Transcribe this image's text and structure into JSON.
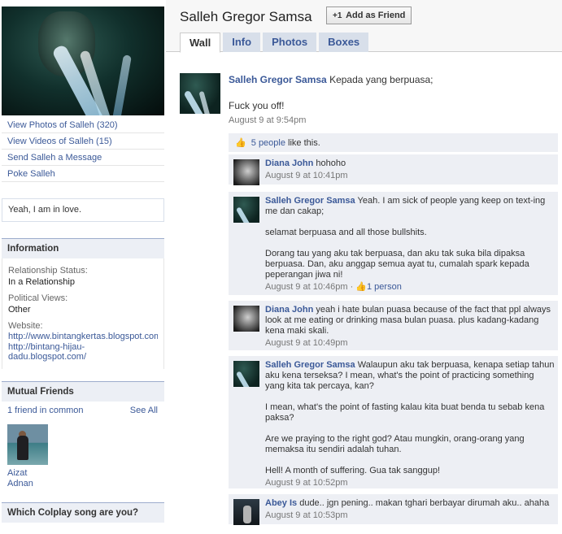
{
  "profile": {
    "name": "Salleh Gregor Samsa",
    "links": [
      "View Photos of Salleh (320)",
      "View Videos of Salleh (15)",
      "Send Salleh a Message",
      "Poke Salleh"
    ],
    "status": "Yeah, I am in love."
  },
  "information": {
    "heading": "Information",
    "relationship_label": "Relationship Status:",
    "relationship_value": "In a Relationship",
    "political_label": "Political Views:",
    "political_value": "Other",
    "website_label": "Website:",
    "website_1": "http://www.bintangkertas.blogspot.com",
    "website_2a": "http://bintang-hijau-",
    "website_2b": "dadu.blogspot.com/"
  },
  "mutual_friends": {
    "heading": "Mutual Friends",
    "count_text": "1 friend in common",
    "see_all": "See All",
    "friend_first": "Aizat",
    "friend_last": "Adnan"
  },
  "quiz": {
    "heading": "Which Colplay song are you?"
  },
  "header": {
    "add_friend": "Add as Friend",
    "add_icon": "+1",
    "tabs": [
      "Wall",
      "Info",
      "Photos",
      "Boxes"
    ]
  },
  "story": {
    "author": "Salleh Gregor Samsa",
    "text1": "Kepada yang berpuasa;",
    "text2": "Fuck you off!",
    "time": "August 9 at 9:54pm",
    "likes_count": "5 people",
    "likes_suffix": "like this."
  },
  "comments": [
    {
      "author": "Diana John",
      "paras": [
        "hohoho"
      ],
      "time": "August 9 at 10:41pm"
    },
    {
      "author": "Salleh Gregor Samsa",
      "paras": [
        "Yeah. I am sick of people yang keep on text-ing me dan cakap;",
        "selamat berpuasa and all those bullshits.",
        "Dorang tau yang aku tak berpuasa, dan aku tak suka bila dipaksa berpuasa. Dan, aku anggap semua ayat tu, cumalah spark kepada peperangan jiwa ni!"
      ],
      "time": "August 9 at 10:46pm",
      "likes": "1 person"
    },
    {
      "author": "Diana John",
      "paras": [
        "yeah i hate bulan puasa because of the fact that ppl always look at me eating or drinking masa bulan puasa. plus kadang-kadang kena maki skali."
      ],
      "time": "August 9 at 10:49pm"
    },
    {
      "author": "Salleh Gregor Samsa",
      "paras": [
        "Walaupun aku tak berpuasa, kenapa setiap tahun aku kena terseksa? I mean, what's the point of practicing something yang kita tak percaya, kan?",
        "I mean, what's the point of fasting kalau kita buat benda tu sebab kena paksa?",
        "Are we praying to the right god? Atau mungkin, orang-orang yang memaksa itu sendiri adalah tuhan.",
        "Hell! A month of suffering. Gua tak sanggup!"
      ],
      "time": "August 9 at 10:52pm"
    },
    {
      "author": "Abey Is",
      "paras": [
        "dude.. jgn pening.. makan tghari berbayar dirumah aku.. ahaha"
      ],
      "time": "August 9 at 10:53pm"
    }
  ]
}
